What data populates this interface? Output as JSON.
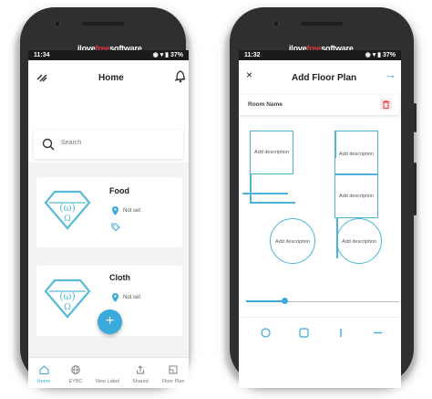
{
  "brand": {
    "part1": "ilove",
    "part2": "free",
    "part3": "software"
  },
  "colors": {
    "accent": "#3ba9d9",
    "plan_line": "#4fb3d9",
    "delete": "#e0353b"
  },
  "left_phone": {
    "status": {
      "time": "11:34",
      "battery": "37%"
    },
    "header": {
      "title": "Home",
      "menu_icon": "menu-slanted-icon",
      "action_icon": "bell-icon"
    },
    "search": {
      "placeholder": "Search"
    },
    "cards": [
      {
        "name": "Food",
        "location": "Not set"
      },
      {
        "name": "Cloth",
        "location": "Not set"
      }
    ],
    "nav": [
      {
        "label": "Home",
        "icon": "home-icon"
      },
      {
        "label": "EYBC",
        "icon": "globe-icon"
      },
      {
        "label": "New Label",
        "icon": "plus-icon"
      },
      {
        "label": "Shared",
        "icon": "share-icon"
      },
      {
        "label": "Floor Plan",
        "icon": "floorplan-icon"
      }
    ],
    "fab_label": "+"
  },
  "right_phone": {
    "status": {
      "time": "11:32",
      "battery": "37%"
    },
    "header": {
      "title": "Add Floor Plan",
      "close": "×",
      "next": "→"
    },
    "room_name_label": "Room Name",
    "rooms": [
      {
        "description": "Add description"
      },
      {
        "description": "Add description"
      },
      {
        "description": "Add description"
      },
      {
        "description": "Add description"
      },
      {
        "description": "Add description"
      }
    ],
    "slider_value": 0.25,
    "tools": [
      "circle-tool-icon",
      "square-tool-icon",
      "line-tool-icon",
      "dash-tool-icon"
    ]
  }
}
